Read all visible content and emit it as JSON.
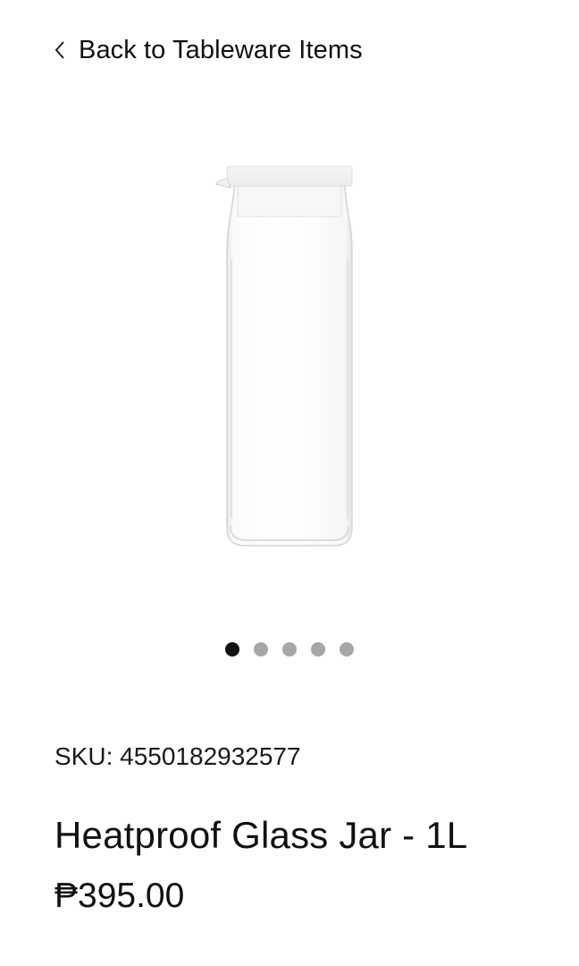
{
  "nav": {
    "back_label": "Back to Tableware Items",
    "back_icon": "chevron-left-icon"
  },
  "gallery": {
    "image_alt": "Heatproof Glass Jar - 1L",
    "slide_count": 5,
    "active_index": 0
  },
  "product": {
    "sku": "SKU: 4550182932577",
    "name": "Heatproof Glass Jar - 1L",
    "price": "₱395.00"
  },
  "colors": {
    "text": "#111111",
    "dot_active": "#111111",
    "dot_inactive": "#a6a6a6",
    "background": "#ffffff"
  }
}
